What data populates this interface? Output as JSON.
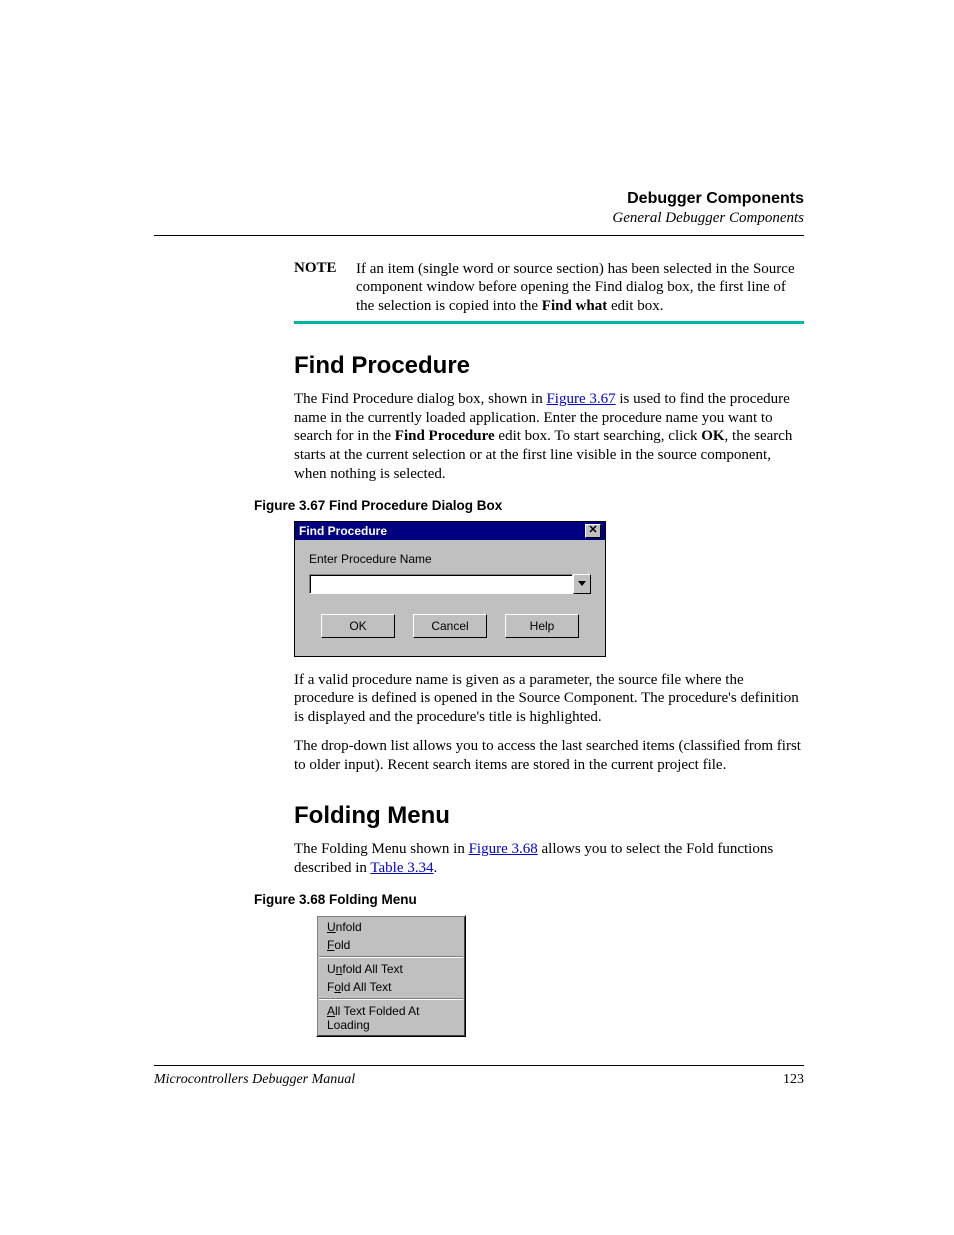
{
  "header": {
    "title": "Debugger Components",
    "subtitle": "General Debugger Components"
  },
  "note": {
    "label": "NOTE",
    "text_pre": "If an item (single word or source section) has been selected in the Source component window before opening the Find dialog box, the first line of the selection is copied into the ",
    "bold": "Find what",
    "text_post": " edit box."
  },
  "section1": {
    "heading": "Find Procedure",
    "p1_pre": "The Find Procedure dialog box, shown in ",
    "p1_link": "Figure 3.67",
    "p1_mid": " is used to find the procedure name in the currently loaded application. Enter the procedure name you want to search for in the ",
    "p1_b1": "Find Procedure",
    "p1_mid2": " edit box. To start searching, click ",
    "p1_b2": "OK",
    "p1_post": ", the search starts at the current selection or at the first line visible in the source component, when nothing is selected.",
    "fig_caption": "Figure 3.67  Find Procedure Dialog Box",
    "p2": "If a valid procedure name is given as a parameter, the source file where the procedure is defined is opened in the Source Component. The procedure's definition is displayed and the procedure's title is highlighted.",
    "p3": "The drop-down list allows you to access the last searched items (classified from first to older input). Recent search items are stored in the current project file."
  },
  "dialog": {
    "title": "Find Procedure",
    "label": "Enter Procedure Name",
    "ok": "OK",
    "cancel": "Cancel",
    "help": "Help"
  },
  "section2": {
    "heading": "Folding Menu",
    "p1_pre": "The Folding Menu shown in ",
    "p1_link1": "Figure 3.68",
    "p1_mid": " allows you to select the Fold functions described in ",
    "p1_link2": "Table 3.34",
    "p1_post": ".",
    "fig_caption": "Figure 3.68  Folding Menu"
  },
  "menu": {
    "items": [
      {
        "u": "U",
        "rest": "nfold"
      },
      {
        "u": "F",
        "rest": "old"
      }
    ],
    "items2": [
      {
        "pre": "U",
        "u": "n",
        "rest": "fold All Text"
      },
      {
        "pre": "F",
        "u": "o",
        "rest": "ld All Text"
      }
    ],
    "items3": [
      {
        "u": "A",
        "rest": "ll Text Folded At Loading"
      }
    ]
  },
  "footer": {
    "title": "Microcontrollers Debugger Manual",
    "page": "123"
  }
}
